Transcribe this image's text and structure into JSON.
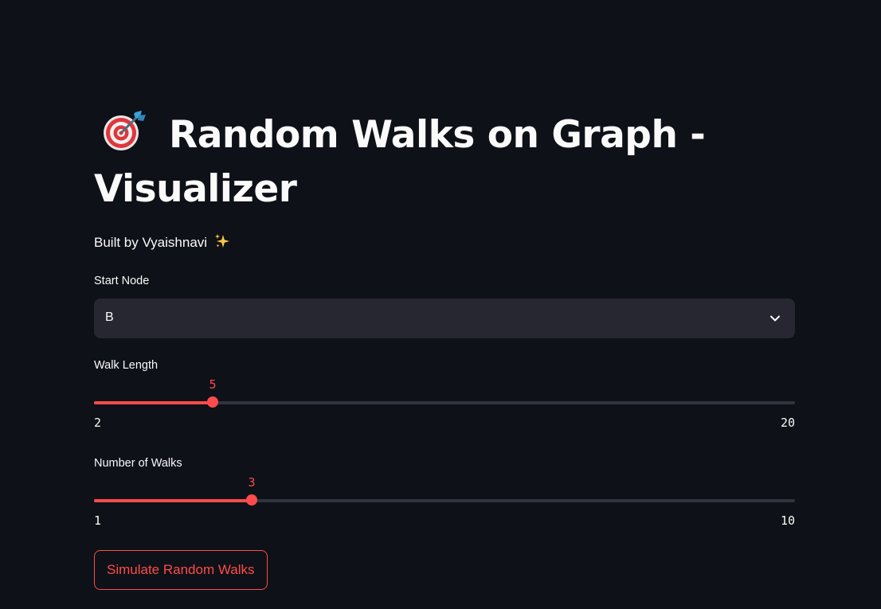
{
  "page": {
    "title": "Random Walks on Graph - Visualizer",
    "title_icon": "dart-target-icon",
    "subtitle": "Built by Vyaishnavi",
    "subtitle_icon": "sparkles-icon"
  },
  "start_node": {
    "label": "Start Node",
    "selected": "B"
  },
  "walk_length": {
    "label": "Walk Length",
    "value": 5,
    "min": 2,
    "max": 20
  },
  "num_walks": {
    "label": "Number of Walks",
    "value": 3,
    "min": 1,
    "max": 10
  },
  "actions": {
    "simulate_label": "Simulate Random Walks"
  },
  "colors": {
    "background": "#0e1117",
    "accent": "#ff4b4b",
    "input_bg": "#262730",
    "track": "#31333f",
    "text": "#fafafa"
  }
}
